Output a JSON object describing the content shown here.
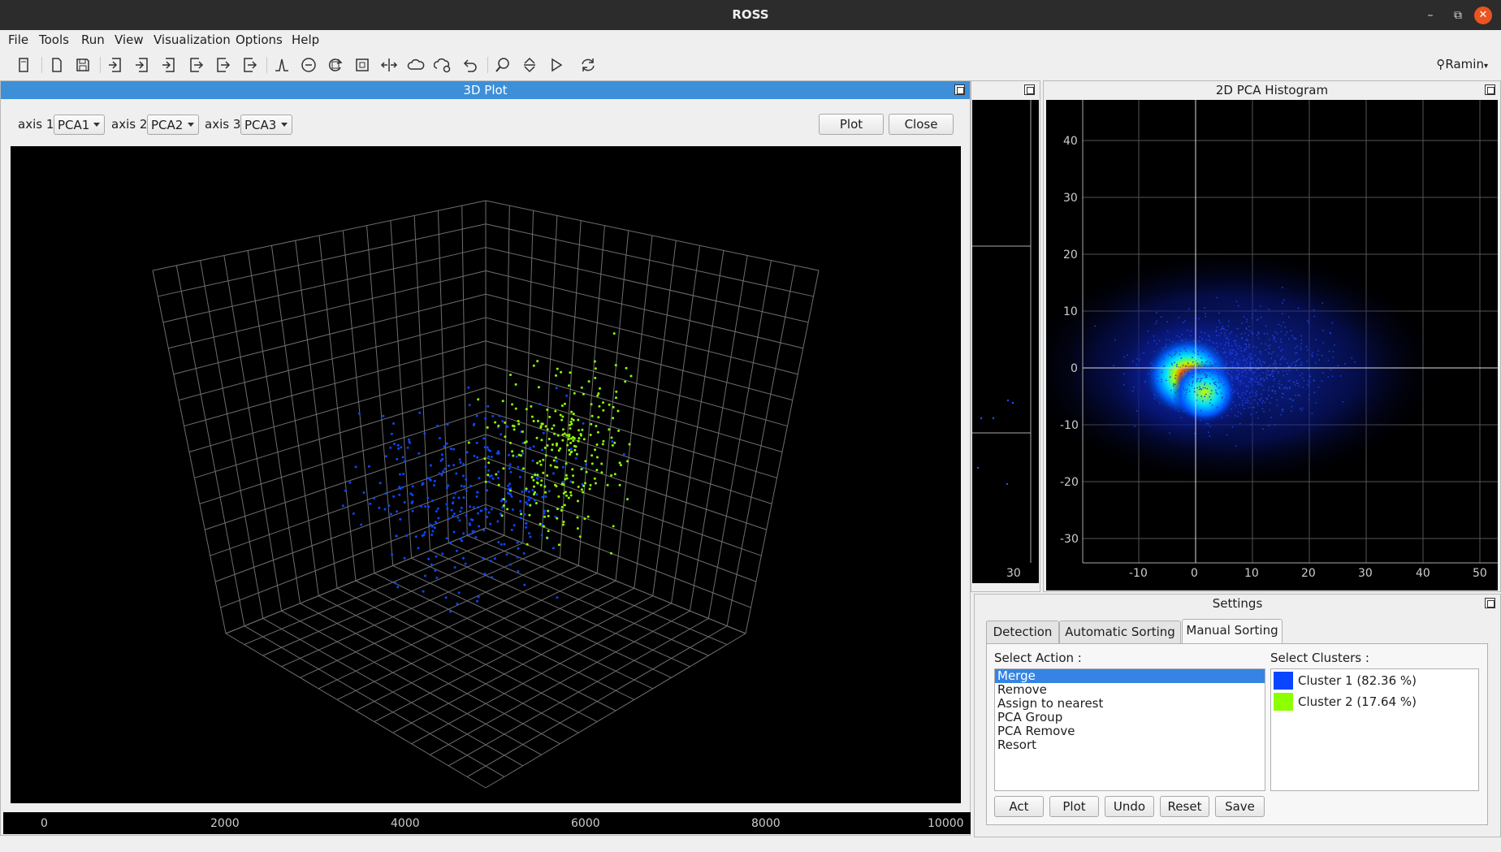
{
  "app": {
    "title": "ROSS"
  },
  "menu": [
    "File",
    "Tools",
    "Run",
    "View",
    "Visualization",
    "Options",
    "Help"
  ],
  "toolbar": {
    "icons": [
      "new-document-icon",
      "new-file-icon",
      "save-icon",
      "import-icon-1",
      "import-icon-2",
      "import-icon-3",
      "export-icon-1",
      "export-icon-2",
      "export-icon-3",
      "detect-icon",
      "remove-circle-icon",
      "refresh-circle-icon",
      "fit-icon",
      "split-icon",
      "cloud-icon",
      "cloud-settings-icon",
      "undo-icon",
      "zoom-icon",
      "vertical-arrows-icon",
      "play-icon",
      "reload-icon"
    ],
    "user": "Ramin"
  },
  "plot3d": {
    "title": "3D Plot",
    "axis1_label": "axis 1",
    "axis1_value": "PCA1",
    "axis2_label": "axis 2",
    "axis2_value": "PCA2",
    "axis3_label": "axis 3",
    "axis3_value": "PCA3",
    "plot_button": "Plot",
    "close_button": "Close"
  },
  "bottom_axis": {
    "ticks": [
      "0",
      "2000",
      "4000",
      "6000",
      "8000",
      "10000"
    ]
  },
  "middle_panel": {
    "tick": "30"
  },
  "hist2d": {
    "title": "2D PCA Histogram",
    "y_ticks": [
      "40",
      "30",
      "20",
      "10",
      "0",
      "-10",
      "-20",
      "-30"
    ],
    "x_ticks": [
      "-10",
      "0",
      "10",
      "20",
      "30",
      "40",
      "50"
    ]
  },
  "settings": {
    "title": "Settings",
    "tabs": [
      "Detection",
      "Automatic Sorting",
      "Manual Sorting"
    ],
    "active_tab": "Manual Sorting",
    "select_action_label": "Select Action :",
    "actions": [
      "Merge",
      "Remove",
      "Assign to nearest",
      "PCA Group",
      "PCA Remove",
      "Resort"
    ],
    "selected_action": "Merge",
    "select_clusters_label": "Select Clusters :",
    "clusters": [
      {
        "label": "Cluster 1 (82.36 %)",
        "color": "#0a46ff"
      },
      {
        "label": "Cluster 2 (17.64 %)",
        "color": "#8cff00"
      }
    ],
    "buttons": {
      "act": "Act",
      "plot": "Plot",
      "undo": "Undo",
      "reset": "Reset",
      "save": "Save"
    }
  },
  "colors": {
    "cluster1": "#0a46ff",
    "cluster2": "#8cff00",
    "accent": "#3584e4",
    "title_active": "#3d8fd8"
  }
}
